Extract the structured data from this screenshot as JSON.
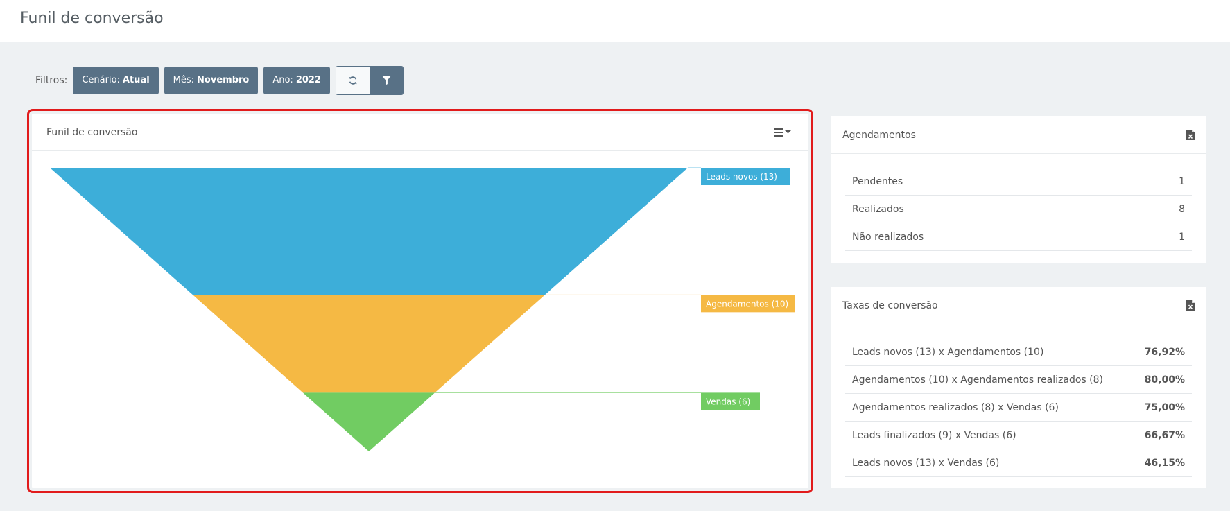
{
  "page_title": "Funil de conversão",
  "filters": {
    "label": "Filtros:",
    "chips": [
      {
        "key": "Cenário:",
        "value": "Atual"
      },
      {
        "key": "Mês:",
        "value": "Novembro"
      },
      {
        "key": "Ano:",
        "value": "2022"
      }
    ],
    "refresh_icon": "refresh-icon",
    "filter_icon": "filter-icon"
  },
  "funnel_panel": {
    "title": "Funil de conversão",
    "menu_icon": "hamburger-menu-icon"
  },
  "chart_data": {
    "type": "funnel",
    "categories": [
      "Leads novos",
      "Agendamentos",
      "Vendas"
    ],
    "values": [
      13,
      10,
      6
    ],
    "labels": [
      "Leads novos (13)",
      "Agendamentos (10)",
      "Vendas (6)"
    ],
    "colors": [
      "#3daed9",
      "#f5b944",
      "#71cc62"
    ]
  },
  "agendamentos": {
    "title": "Agendamentos",
    "icon": "excel-export-icon",
    "rows": [
      {
        "label": "Pendentes",
        "value": "1"
      },
      {
        "label": "Realizados",
        "value": "8"
      },
      {
        "label": "Não realizados",
        "value": "1"
      }
    ]
  },
  "taxas": {
    "title": "Taxas de conversão",
    "icon": "excel-export-icon",
    "rows": [
      {
        "label": "Leads novos (13) x Agendamentos (10)",
        "value": "76,92%"
      },
      {
        "label": "Agendamentos (10) x Agendamentos realizados (8)",
        "value": "80,00%"
      },
      {
        "label": "Agendamentos realizados (8) x Vendas (6)",
        "value": "75,00%"
      },
      {
        "label": "Leads finalizados (9) x Vendas (6)",
        "value": "66,67%"
      },
      {
        "label": "Leads novos (13) x Vendas (6)",
        "value": "46,15%"
      }
    ]
  }
}
